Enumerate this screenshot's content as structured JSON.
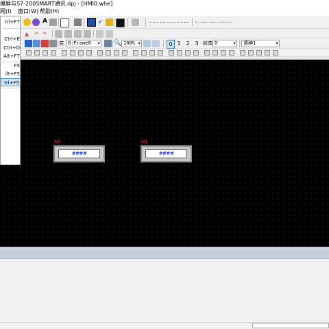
{
  "window": {
    "title": "摸屏与S7-200SMART通讯.dpj - [HMI0.whe]"
  },
  "menubar": {
    "items": [
      "网(I)",
      "窗口(W)",
      "帮助(H)"
    ]
  },
  "toolbar": {
    "frame_combo": "0:Frame0",
    "zoom_combo": "100%",
    "state_numbers": [
      "0",
      "1",
      "2",
      "3"
    ],
    "state_label": "状态",
    "state_combo": "0",
    "language_combo": "语种1"
  },
  "dropdown": {
    "items": [
      {
        "shortcut": "trl+F7"
      },
      {
        "shortcut": ""
      },
      {
        "shortcut": "Ctrl+E"
      },
      {
        "shortcut": "Ctrl+D"
      },
      {
        "shortcut": "Alt+F7"
      },
      {
        "shortcut": "F5"
      },
      {
        "shortcut": "ift+F5"
      },
      {
        "shortcut": "trl+F5"
      }
    ]
  },
  "canvas": {
    "background": "#000000",
    "objects": [
      {
        "id_label": "N0",
        "value": "####"
      },
      {
        "id_label": "N1",
        "value": "####"
      }
    ]
  },
  "colors": {
    "object_label": "#ff2a2a",
    "numeric_value": "#1a3cff",
    "selection": "#cce8ff"
  }
}
